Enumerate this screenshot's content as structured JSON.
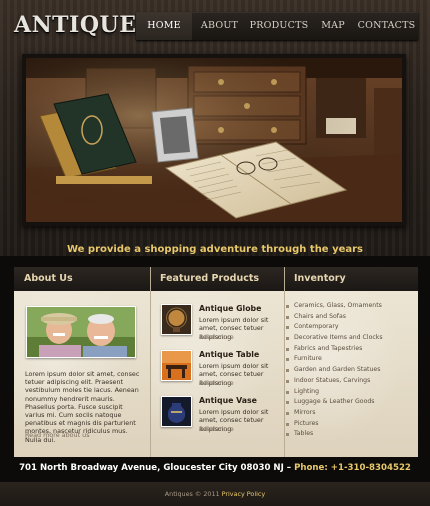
{
  "header": {
    "logo": "ANTIQUES",
    "nav": [
      {
        "label": "HOME",
        "active": true
      },
      {
        "label": "ABOUT",
        "active": false
      },
      {
        "label": "PRODUCTS",
        "active": false
      },
      {
        "label": "MAP",
        "active": false
      },
      {
        "label": "CONTACTS",
        "active": false
      }
    ]
  },
  "tagline": "We provide a shopping adventure through the years",
  "about": {
    "heading": "About Us",
    "text": "Lorem ipsum dolor sit amet, consec tetuer adipiscing elit. Praesent vestibulum moles tie lacus. Aenean nonummy hendrerit mauris. Phasellus porta. Fusce suscipit varius mi. Cum sociis natoque penatibus et magnis dis parturient montes, nascetur ridiculus mus. Nulla dui.",
    "more": "Read more about us"
  },
  "featured": {
    "heading": "Featured Products",
    "items": [
      {
        "title": "Antique Globe",
        "desc": "Lorem ipsum dolor sit amet, consec tetuer adipiscing",
        "more": "Read more"
      },
      {
        "title": "Antique Table",
        "desc": "Lorem ipsum dolor sit amet, consec tetuer adipiscing",
        "more": "Read more"
      },
      {
        "title": "Antique Vase",
        "desc": "Lorem ipsum dolor sit amet, consec tetuer adipiscing",
        "more": "Read more"
      }
    ]
  },
  "inventory": {
    "heading": "Inventory",
    "items": [
      "Ceramics, Glass, Ornaments",
      "Chairs and Sofas",
      "Contemporary",
      "Decorative Items and Clocks",
      "Fabrics and Tapestries",
      "Furniture",
      "Garden and Garden Statues",
      "Indoor Statues, Carvings",
      "Lighting",
      "Luggage & Leather Goods",
      "Mirrors",
      "Pictures",
      "Tables"
    ]
  },
  "contact": {
    "address": "701 North Broadway Avenue, Gloucester City 08030 NJ –",
    "phone": "Phone: +1-310-8304522"
  },
  "footer": {
    "copyright": "Antiques © 2011",
    "policy": "Privacy Policy"
  },
  "colors": {
    "accent": "#e8c86a",
    "panel": "#e8e0ce",
    "dark": "#0c0b0a"
  }
}
